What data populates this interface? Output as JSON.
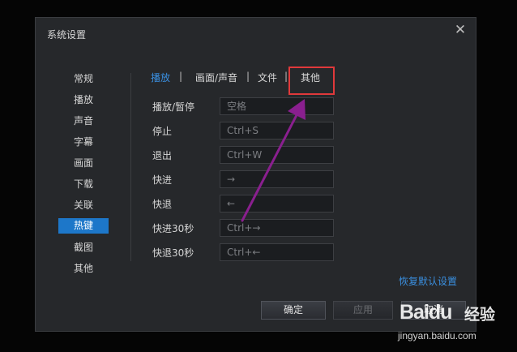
{
  "dialog": {
    "title": "系统设置",
    "close_glyph": "✕"
  },
  "sidebar": {
    "items": [
      {
        "label": "常规"
      },
      {
        "label": "播放"
      },
      {
        "label": "声音"
      },
      {
        "label": "字幕"
      },
      {
        "label": "画面"
      },
      {
        "label": "下载"
      },
      {
        "label": "关联"
      },
      {
        "label": "热键",
        "active": true
      },
      {
        "label": "截图"
      },
      {
        "label": "其他"
      }
    ]
  },
  "tabs": [
    {
      "label": "播放",
      "active": true
    },
    {
      "label": "画面/声音"
    },
    {
      "label": "文件"
    },
    {
      "label": "其他"
    }
  ],
  "tab_separator": "|",
  "hotkeys": [
    {
      "label": "播放/暂停",
      "value": "空格"
    },
    {
      "label": "停止",
      "value": "Ctrl+S"
    },
    {
      "label": "退出",
      "value": "Ctrl+W"
    },
    {
      "label": "快进",
      "value": "→"
    },
    {
      "label": "快退",
      "value": "←"
    },
    {
      "label": "快进30秒",
      "value": "Ctrl+→"
    },
    {
      "label": "快退30秒",
      "value": "Ctrl+←"
    }
  ],
  "restore_defaults": "恢复默认设置",
  "buttons": {
    "ok": "确定",
    "apply": "应用",
    "cancel": "取消"
  },
  "watermark": {
    "logo": "Baidu",
    "text": "经验",
    "url": "jingyan.baidu.com"
  },
  "colors": {
    "accent": "#1d77c9",
    "link": "#3a8fe0",
    "highlight": "#e0393b",
    "arrow": "#8a1f8f"
  }
}
